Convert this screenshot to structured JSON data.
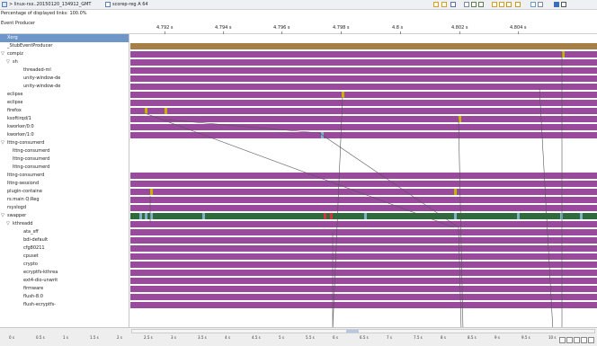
{
  "breadcrumb": {
    "path": "> linux-rxx..20150120_134912_GMT",
    "tab": "scorep-reg A 64"
  },
  "links_percentage": "Percentage of displayed links: 100.0%",
  "header": {
    "event_producer": "Event Producer",
    "time_ticks": [
      "4.792 s",
      "4.794 s",
      "4.796 s",
      "4.798 s",
      "4.8 s",
      "4.802 s",
      "4.804 s"
    ]
  },
  "tree": [
    {
      "label": "Xorg",
      "depth": 0,
      "toggle": "",
      "selected": true
    },
    {
      "label": "_StubEventProducer",
      "depth": 0,
      "toggle": ""
    },
    {
      "label": "compiz",
      "depth": 0,
      "toggle": "▽"
    },
    {
      "label": "sh",
      "depth": 1,
      "toggle": "▽"
    },
    {
      "label": "threaded-ml",
      "depth": 3,
      "toggle": ""
    },
    {
      "label": "unity-window-de",
      "depth": 3,
      "toggle": ""
    },
    {
      "label": "unity-window-de",
      "depth": 3,
      "toggle": ""
    },
    {
      "label": "eclipse",
      "depth": 0,
      "toggle": ""
    },
    {
      "label": "eclipse",
      "depth": 0,
      "toggle": ""
    },
    {
      "label": "firefox",
      "depth": 0,
      "toggle": ""
    },
    {
      "label": "ksoftirqd/1",
      "depth": 0,
      "toggle": ""
    },
    {
      "label": "kworker/0:0",
      "depth": 0,
      "toggle": ""
    },
    {
      "label": "kworker/1:0",
      "depth": 0,
      "toggle": ""
    },
    {
      "label": "lttng-consumerd",
      "depth": 0,
      "toggle": "▽"
    },
    {
      "label": "lttng-consumerd",
      "depth": 1,
      "toggle": ""
    },
    {
      "label": "lttng-consumerd",
      "depth": 1,
      "toggle": ""
    },
    {
      "label": "lttng-consumerd",
      "depth": 1,
      "toggle": ""
    },
    {
      "label": "lttng-consumerd",
      "depth": 0,
      "toggle": ""
    },
    {
      "label": "lttng-sessiond",
      "depth": 0,
      "toggle": ""
    },
    {
      "label": "plugin-containe",
      "depth": 0,
      "toggle": ""
    },
    {
      "label": "rs:main Q:Reg",
      "depth": 0,
      "toggle": ""
    },
    {
      "label": "rsyslogd",
      "depth": 0,
      "toggle": ""
    },
    {
      "label": "swapper",
      "depth": 0,
      "toggle": "▽"
    },
    {
      "label": "kthreadd",
      "depth": 1,
      "toggle": "▽"
    },
    {
      "label": "ata_sff",
      "depth": 3,
      "toggle": ""
    },
    {
      "label": "bdi-default",
      "depth": 3,
      "toggle": ""
    },
    {
      "label": "cfg80211",
      "depth": 3,
      "toggle": ""
    },
    {
      "label": "cpuset",
      "depth": 3,
      "toggle": ""
    },
    {
      "label": "crypto",
      "depth": 3,
      "toggle": ""
    },
    {
      "label": "ecryptfs-kthrea",
      "depth": 3,
      "toggle": ""
    },
    {
      "label": "ext4-dio-unwrit",
      "depth": 3,
      "toggle": ""
    },
    {
      "label": "firmware",
      "depth": 3,
      "toggle": ""
    },
    {
      "label": "flush-8:0",
      "depth": 3,
      "toggle": ""
    },
    {
      "label": "flush-ecryptfs-",
      "depth": 3,
      "toggle": ""
    }
  ],
  "lanes": [
    {
      "state": "none"
    },
    {
      "state": "olive"
    },
    {
      "state": "purple"
    },
    {
      "state": "purple"
    },
    {
      "state": "purple"
    },
    {
      "state": "purple"
    },
    {
      "state": "purple"
    },
    {
      "state": "purple"
    },
    {
      "state": "purple"
    },
    {
      "state": "purple"
    },
    {
      "state": "purple"
    },
    {
      "state": "purple"
    },
    {
      "state": "purple"
    },
    {
      "state": "none"
    },
    {
      "state": "none"
    },
    {
      "state": "none"
    },
    {
      "state": "none"
    },
    {
      "state": "purple"
    },
    {
      "state": "purple"
    },
    {
      "state": "purple"
    },
    {
      "state": "purple"
    },
    {
      "state": "purple"
    },
    {
      "state": "green"
    },
    {
      "state": "purple"
    },
    {
      "state": "purple"
    },
    {
      "state": "purple"
    },
    {
      "state": "purple"
    },
    {
      "state": "purple"
    },
    {
      "state": "purple"
    },
    {
      "state": "purple"
    },
    {
      "state": "purple"
    },
    {
      "state": "purple"
    },
    {
      "state": "purple"
    },
    {
      "state": "purple"
    }
  ],
  "colors": {
    "purple": "#9a4a9d",
    "olive": "#a67f46",
    "green": "#2e6a3c",
    "selected": "#6f96c9",
    "link": "#555555",
    "marker_yellow": "#c8b400",
    "marker_red": "#d9333a",
    "marker_cyan": "#7fb2c9"
  },
  "bottom_axis": {
    "labels": [
      "0 s",
      "0.5 s",
      "1 s",
      "1.5 s",
      "2 s",
      "2.5 s",
      "3 s",
      "3.5 s",
      "4 s",
      "4.5 s",
      "5 s",
      "5.5 s",
      "6 s",
      "6.5 s",
      "7 s",
      "7.5 s",
      "8 s",
      "8.5 s",
      "9 s",
      "9.5 s",
      "10 s"
    ]
  },
  "toolbar_icons": [
    "filter-icon",
    "pin-icon",
    "hide-arrows-icon",
    "home-icon",
    "zoom-in-icon",
    "zoom-out-icon",
    "prev-event-icon",
    "next-event-icon",
    "prev-marker-icon",
    "next-marker-icon",
    "legend-icon",
    "collapse-icon",
    "layout-icon",
    "menu-icon"
  ],
  "bottom_icons": [
    "time-link-icon",
    "sync-icon",
    "pin-view-icon",
    "camera-icon",
    "pin-lock-icon"
  ]
}
